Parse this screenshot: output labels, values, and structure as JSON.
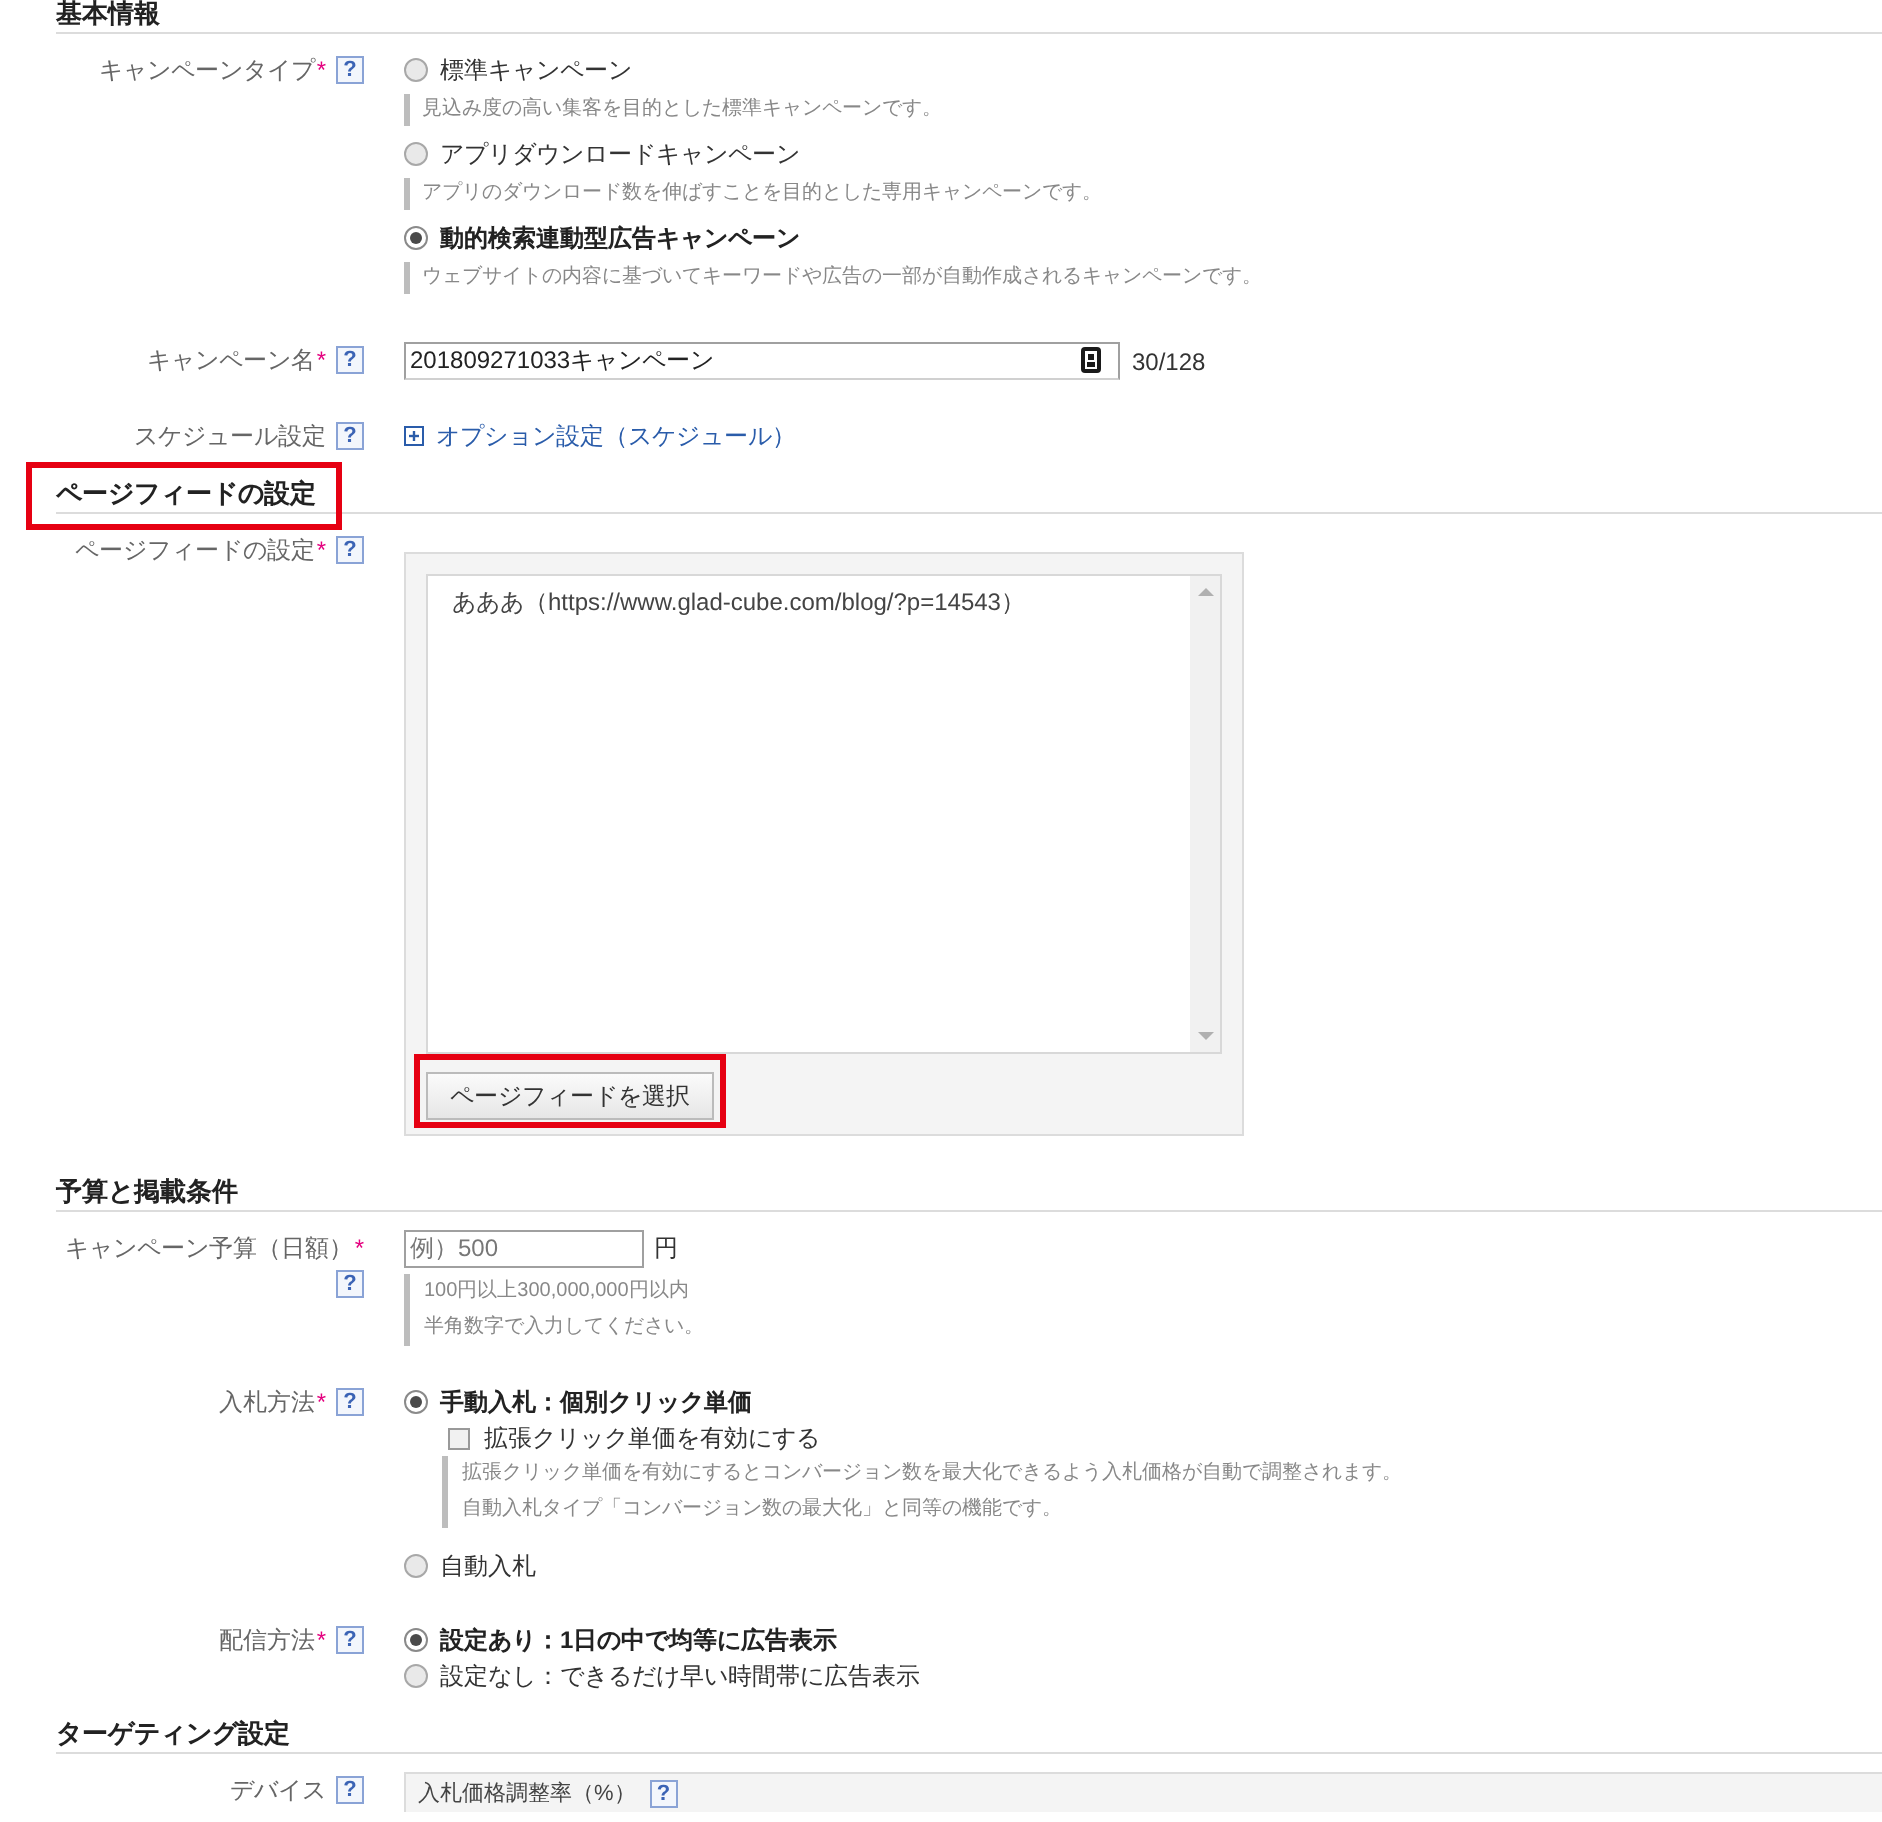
{
  "sections": [
    {
      "title": "基本情報",
      "highlighted": false,
      "rows": [
        {
          "kind": "radio_group",
          "label": "キャンペーンタイプ",
          "required_mark": "*",
          "help": "?",
          "options": [
            {
              "label": "標準キャンペーン",
              "selected": false,
              "description": "見込み度の高い集客を目的とした標準キャンペーンです。"
            },
            {
              "label": "アプリダウンロードキャンペーン",
              "selected": false,
              "description": "アプリのダウンロード数を伸ばすことを目的とした専用キャンペーンです。"
            },
            {
              "label": "動的検索連動型広告キャンペーン",
              "selected": true,
              "description": "ウェブサイトの内容に基づいてキーワードや広告の一部が自動作成されるキャンペーンです。"
            }
          ]
        },
        {
          "kind": "text_input",
          "label": "キャンペーン名",
          "required_mark": "*",
          "help": "?",
          "value": "201809271033キャンペーン",
          "counter": "30/128"
        },
        {
          "kind": "expander",
          "label": "スケジュール設定",
          "help": "?",
          "link": "オプション設定（スケジュール）",
          "expanded": false
        }
      ]
    },
    {
      "title": "ページフィードの設定",
      "highlighted": true,
      "rows": [
        {
          "kind": "feed_list",
          "label": "ページフィードの設定",
          "required_mark": "*",
          "help": "?",
          "items": [
            "あああ（https://www.glad-cube.com/blog/?p=14543）"
          ],
          "button": {
            "label": "ページフィードを選択",
            "highlighted": true
          }
        }
      ]
    },
    {
      "title": "予算と掲載条件",
      "highlighted": false,
      "rows": [
        {
          "kind": "amount_input",
          "label": "キャンペーン予算（日額）",
          "required_mark": "*",
          "help": "?",
          "placeholder": "例）500",
          "unit": "円",
          "hints": [
            "100円以上300,000,000円以内",
            "半角数字で入力してください。"
          ]
        },
        {
          "kind": "radio_group",
          "label": "入札方法",
          "required_mark": "*",
          "help": "?",
          "options": [
            {
              "label": "手動入札：個別クリック単価",
              "selected": true,
              "checkbox": {
                "label": "拡張クリック単価を有効にする",
                "checked": false,
                "hints": [
                  "拡張クリック単価を有効にするとコンバージョン数を最大化できるよう入札価格が自動で調整されます。",
                  "自動入札タイプ「コンバージョン数の最大化」と同等の機能です。"
                ]
              }
            },
            {
              "label": "自動入札",
              "selected": false
            }
          ]
        },
        {
          "kind": "radio_group",
          "label": "配信方法",
          "required_mark": "*",
          "help": "?",
          "options": [
            {
              "label": "設定あり：1日の中で均等に広告表示",
              "selected": true
            },
            {
              "label": "設定なし：できるだけ早い時間帯に広告表示",
              "selected": false
            }
          ]
        }
      ]
    },
    {
      "title": "ターゲティング設定",
      "highlighted": false,
      "rows": [
        {
          "kind": "panel",
          "label": "デバイス",
          "help": "?",
          "text": "入札価格調整率（%）",
          "text_help": "?"
        }
      ]
    }
  ]
}
